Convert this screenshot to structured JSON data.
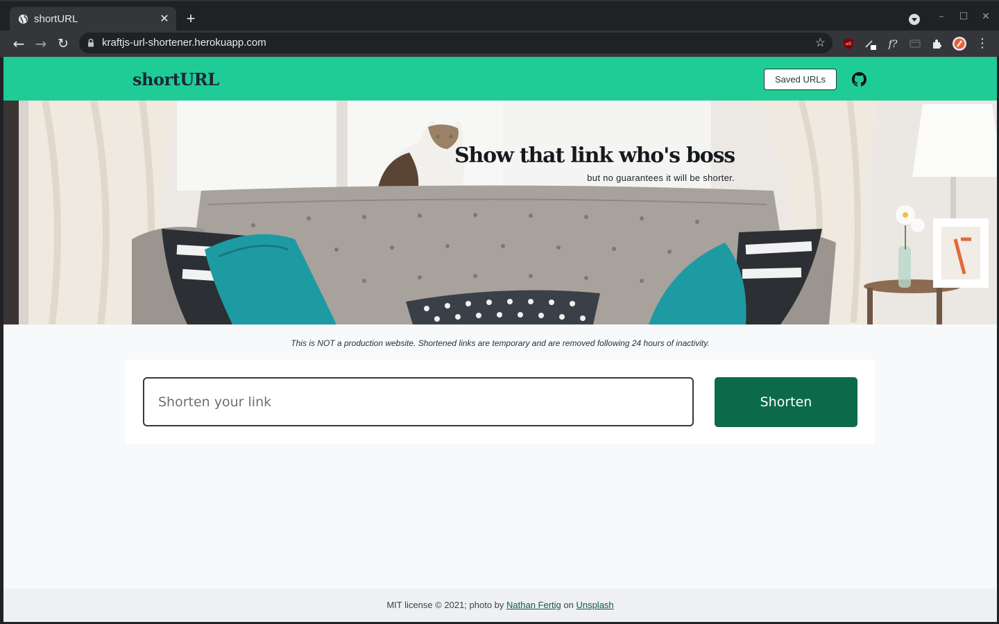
{
  "browser": {
    "tab_title": "shortURL",
    "tab_close": "✕",
    "new_tab": "+",
    "url": "kraftjs-url-shortener.herokuapp.com",
    "controls": {
      "minimize": "–",
      "maximize": "☐",
      "close": "✕"
    }
  },
  "nav": {
    "brand": "shortURL",
    "saved_urls_label": "Saved URLs"
  },
  "hero": {
    "title": "Show that link who's boss",
    "subtitle": "but no guarantees it will be shorter."
  },
  "notice": "This is NOT a production website. Shortened links are temporary and are removed following 24 hours of inactivity.",
  "form": {
    "input_placeholder": "Shorten your link",
    "input_value": "",
    "submit_label": "Shorten"
  },
  "footer": {
    "prefix": "MIT license © 2021; photo by ",
    "photographer": "Nathan Fertig",
    "middle": " on ",
    "source": "Unsplash"
  },
  "colors": {
    "nav_bg": "#20cc96",
    "button_bg": "#0c6a4a",
    "page_bg": "#f8f9fa"
  }
}
